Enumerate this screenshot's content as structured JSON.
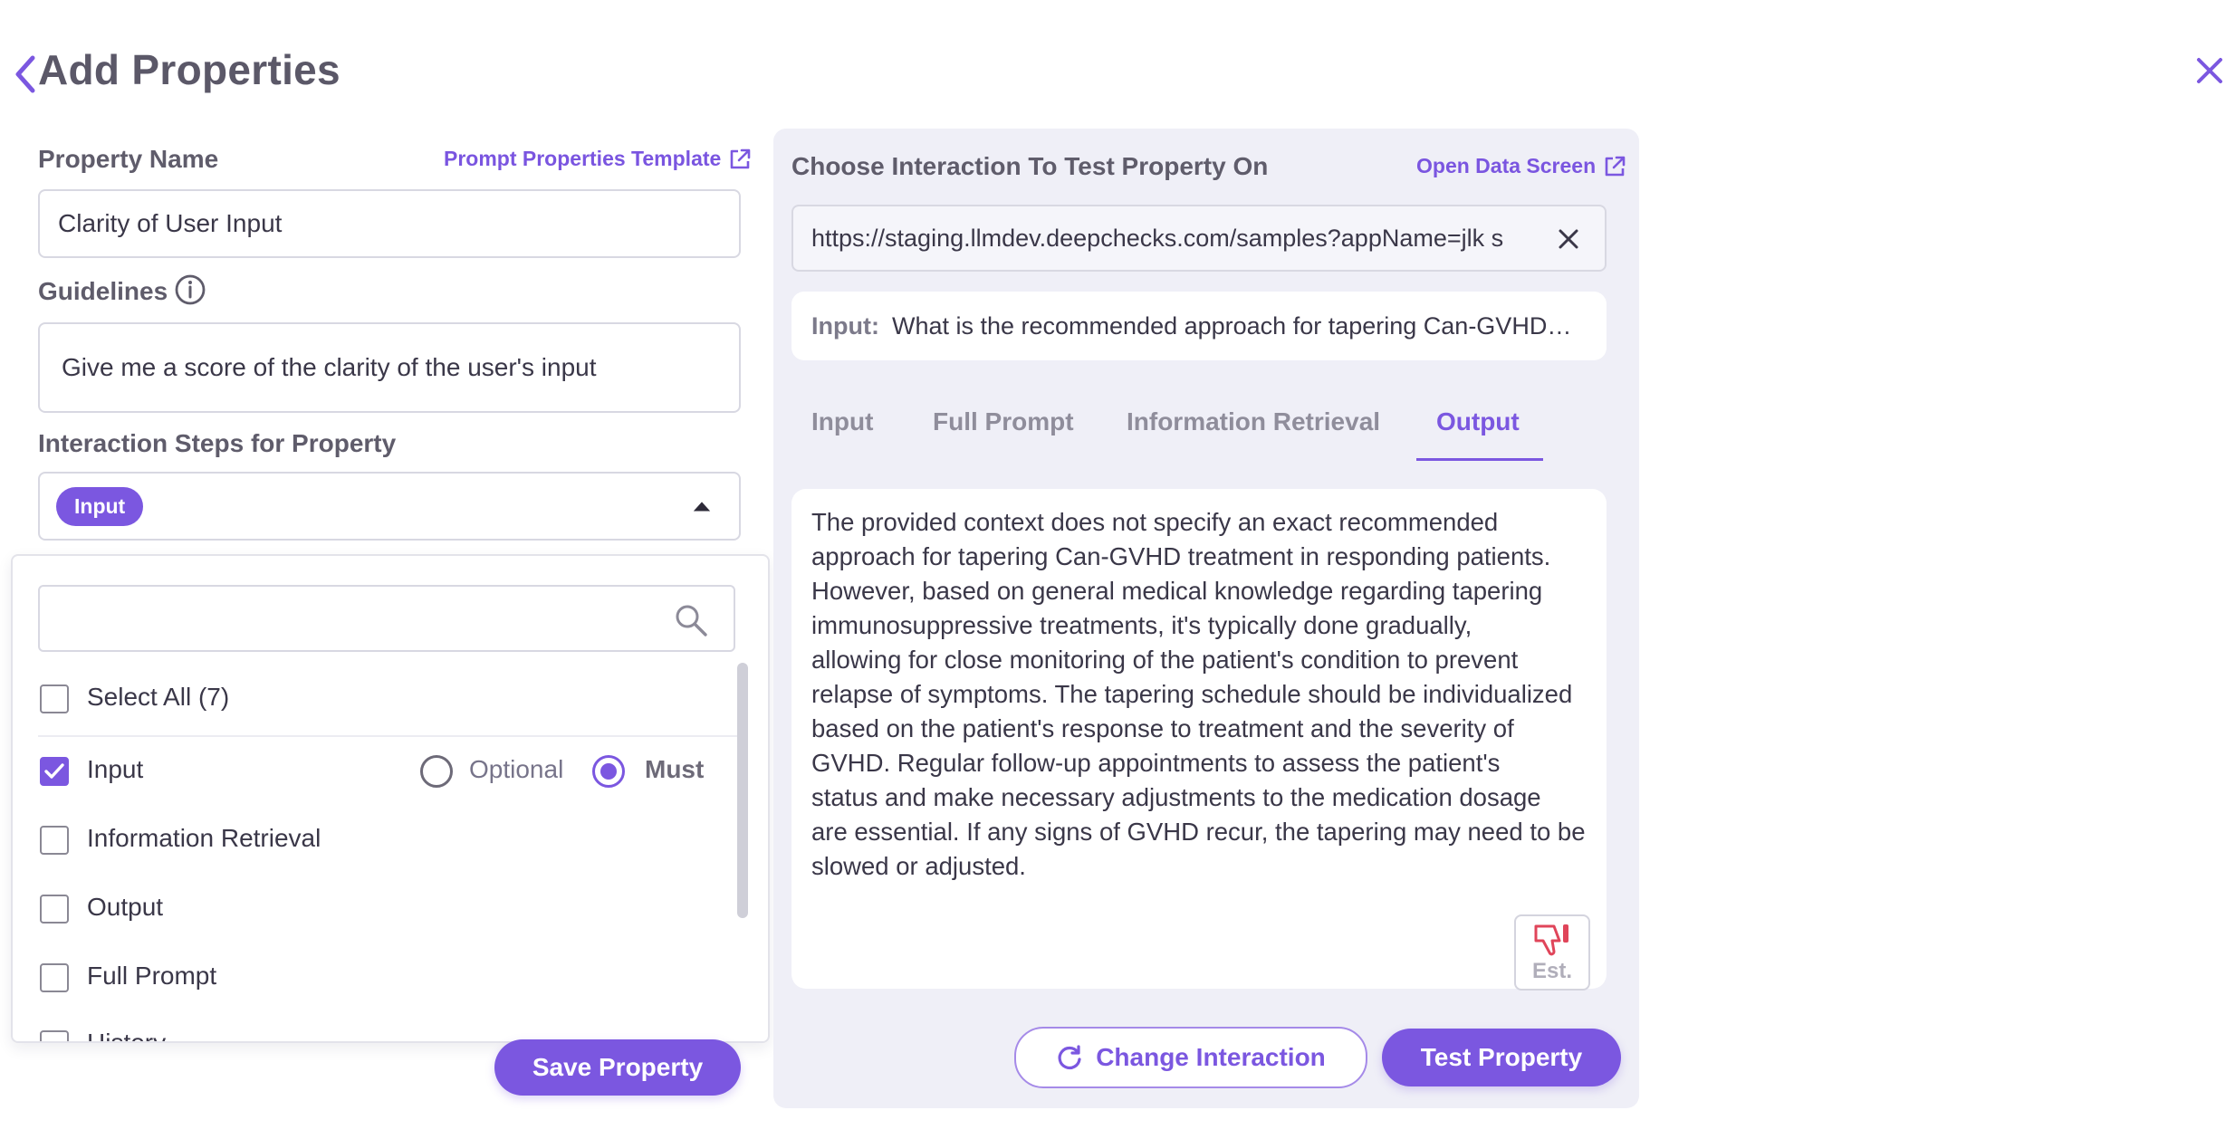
{
  "header": {
    "title": "Add Properties",
    "back_icon": "chevron-left-icon",
    "close_icon": "close-icon"
  },
  "left": {
    "property_name_label": "Property Name",
    "template_link": "Prompt Properties Template",
    "property_name_value": "Clarity of User Input",
    "guidelines_label": "Guidelines",
    "guidelines_value": "Give me a score of the clarity of the user's input",
    "steps_label": "Interaction Steps for Property",
    "selected_chip": "Input",
    "dropdown": {
      "search_placeholder": "",
      "select_all": "Select All (7)",
      "options": [
        {
          "label": "Input",
          "checked": true
        },
        {
          "label": "Information Retrieval",
          "checked": false
        },
        {
          "label": "Output",
          "checked": false
        },
        {
          "label": "Full Prompt",
          "checked": false
        },
        {
          "label": "History",
          "checked": false
        }
      ],
      "radio_optional": "Optional",
      "radio_must": "Must",
      "radio_selected": "Must"
    },
    "save_button": "Save Property"
  },
  "right": {
    "title": "Choose Interaction To Test Property On",
    "open_link": "Open Data Screen",
    "url_value": "https://staging.llmdev.deepchecks.com/samples?appName=jlk s",
    "input_label": "Input:",
    "input_value": "What is the recommended approach for tapering Can-GVHD…",
    "tabs": [
      {
        "label": "Input",
        "active": false
      },
      {
        "label": "Full Prompt",
        "active": false
      },
      {
        "label": "Information Retrieval",
        "active": false
      },
      {
        "label": "Output",
        "active": true
      }
    ],
    "output_lines": [
      "The provided context does not specify an exact recommended",
      "approach for tapering Can-GVHD treatment in responding patients.",
      "However, based on general medical knowledge regarding tapering",
      "immunosuppressive treatments, it's typically done gradually,",
      "allowing for close monitoring of the patient's condition to prevent",
      "relapse of symptoms. The tapering schedule should be individualized",
      "based on the patient's response to treatment and the severity of",
      "GVHD. Regular follow-up appointments to assess the patient's",
      "status and make necessary adjustments to the medication dosage",
      "are essential. If any signs of GVHD recur, the tapering may need to be",
      "slowed or adjusted."
    ],
    "est_label": "Est.",
    "change_button": "Change Interaction",
    "test_button": "Test Property"
  },
  "colors": {
    "accent": "#7b57e0",
    "panel_bg": "#efeff7",
    "thumb_red": "#e0455a"
  }
}
